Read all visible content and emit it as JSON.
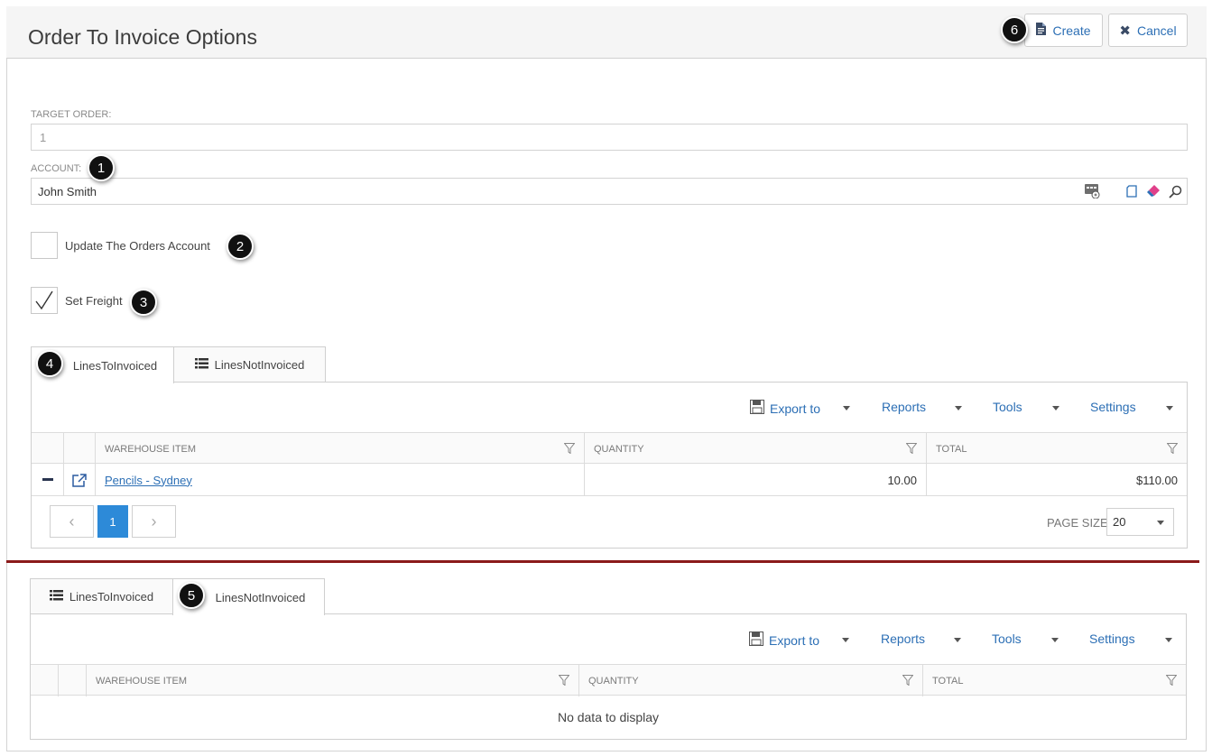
{
  "page": {
    "title": "Order To Invoice Options",
    "create_label": "Create",
    "cancel_label": "Cancel"
  },
  "form": {
    "target_order_label": "TARGET ORDER:",
    "target_order_value": "1",
    "account_label": "ACCOUNT:",
    "account_value": "John Smith",
    "update_account_label": "Update The Orders Account",
    "update_account_checked": false,
    "set_freight_label": "Set Freight",
    "set_freight_checked": true
  },
  "badges": [
    "1",
    "2",
    "3",
    "4",
    "5",
    "6"
  ],
  "tabs_top": {
    "tab1": "LinesToInvoiced",
    "tab2": "LinesNotInvoiced",
    "active": "LinesToInvoiced"
  },
  "tabs_bottom": {
    "tab1": "LinesToInvoiced",
    "tab2": "LinesNotInvoiced",
    "active": "LinesNotInvoiced"
  },
  "toolbar": {
    "export": "Export to",
    "reports": "Reports",
    "tools": "Tools",
    "settings": "Settings"
  },
  "grid": {
    "col_item": "WAREHOUSE ITEM",
    "col_qty": "QUANTITY",
    "col_total": "TOTAL",
    "rows": [
      {
        "item": "Pencils - Sydney",
        "quantity": "10.00",
        "total": "$110.00"
      }
    ],
    "page": "1",
    "page_size_label": "PAGE SIZE",
    "page_size": "20"
  },
  "grid2": {
    "empty_text": "No data to display"
  },
  "colors": {
    "accent": "#2c6fb5",
    "divider": "#8b1a1a",
    "page_active": "#2d8ad8"
  }
}
